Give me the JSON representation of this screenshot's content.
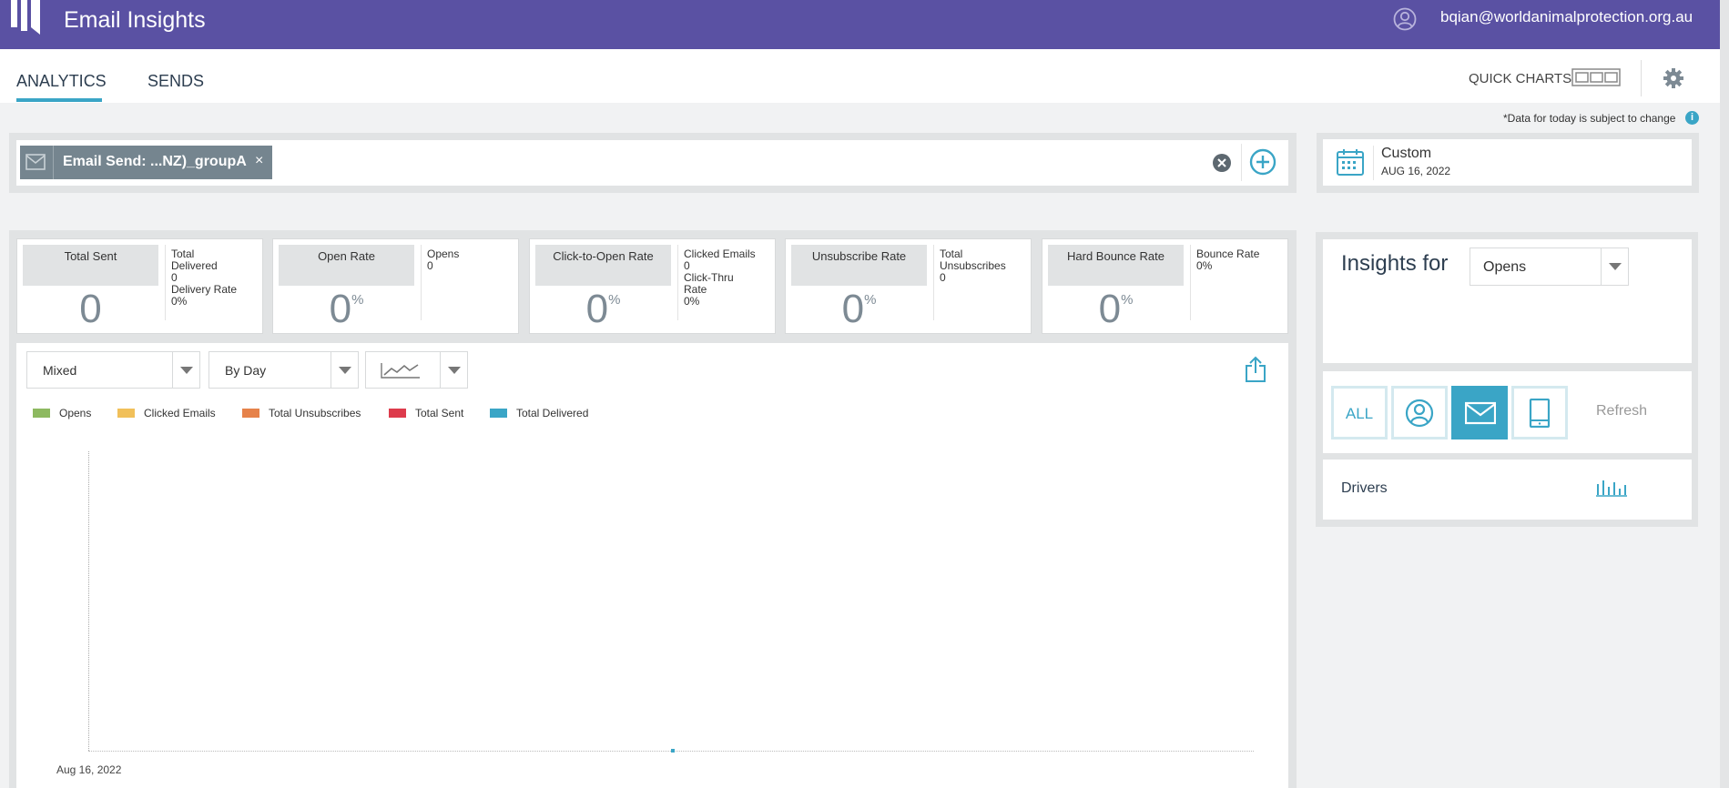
{
  "header": {
    "app_title": "Email Insights",
    "user_email": "bqian@worldanimalprotection.org.au",
    "brand_color": "#5a51a3"
  },
  "nav": {
    "tabs": [
      {
        "label": "ANALYTICS",
        "active": true
      },
      {
        "label": "SENDS",
        "active": false
      }
    ],
    "quick_charts_label": "QUICK CHARTS",
    "data_note": "*Data for today is subject to change",
    "info_icon_glyph": "i"
  },
  "filter": {
    "chip_label": "Email Send: ...NZ)_groupA",
    "chip_close": "×"
  },
  "date_range": {
    "label": "Custom",
    "value": "AUG 16, 2022"
  },
  "metrics": [
    {
      "title": "Total Sent",
      "value": "0",
      "unit": "",
      "details": [
        "Total",
        "Delivered",
        "0",
        "Delivery Rate",
        "0%"
      ]
    },
    {
      "title": "Open Rate",
      "value": "0",
      "unit": "%",
      "details": [
        "Opens",
        "0"
      ]
    },
    {
      "title": "Click-to-Open Rate",
      "value": "0",
      "unit": "%",
      "details": [
        "Clicked Emails",
        "0",
        "Click-Thru",
        "Rate",
        "0%"
      ]
    },
    {
      "title": "Unsubscribe Rate",
      "value": "0",
      "unit": "%",
      "details": [
        "Total",
        "Unsubscribes",
        "0"
      ]
    },
    {
      "title": "Hard Bounce Rate",
      "value": "0",
      "unit": "%",
      "details": [
        "Bounce Rate",
        "0%"
      ]
    }
  ],
  "chart_controls": {
    "metric_select": "Mixed",
    "interval_select": "By Day",
    "chart_type_icon": "line-chart-icon"
  },
  "chart_data": {
    "type": "line",
    "x": [
      "Aug 16, 2022"
    ],
    "series": [
      {
        "name": "Opens",
        "color": "#8db960",
        "values": [
          0
        ]
      },
      {
        "name": "Clicked Emails",
        "color": "#f1c05a",
        "values": [
          0
        ]
      },
      {
        "name": "Total Unsubscribes",
        "color": "#e6824a",
        "values": [
          0
        ]
      },
      {
        "name": "Total Sent",
        "color": "#dd3b4c",
        "values": [
          0
        ]
      },
      {
        "name": "Total Delivered",
        "color": "#3aa5c6",
        "values": [
          0
        ]
      }
    ],
    "xtick_labels": [
      "Aug 16, 2022"
    ],
    "legend_position": "top-left",
    "grid": false
  },
  "insights": {
    "label": "Insights for",
    "selected": "Opens",
    "device_buttons": [
      {
        "label": "ALL",
        "icon": "all-text"
      },
      {
        "label": "",
        "icon": "person-icon"
      },
      {
        "label": "",
        "icon": "email-icon",
        "active": true
      },
      {
        "label": "",
        "icon": "tablet-icon"
      }
    ],
    "refresh_label": "Refresh",
    "drivers_label": "Drivers"
  }
}
